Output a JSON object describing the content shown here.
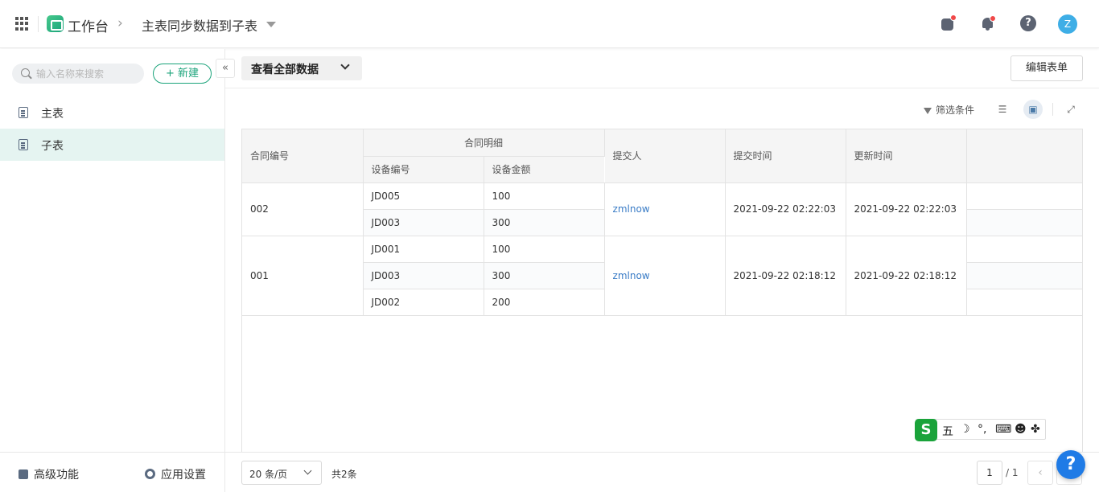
{
  "header": {
    "workspace_label": "工作台",
    "breadcrumb_separator": "›",
    "app_title": "主表同步数据到子表",
    "help_glyph": "?",
    "avatar_initial": "Z",
    "icons": [
      "apps-grid-icon",
      "app-logo-icon",
      "chevron-right-icon",
      "caret-down-icon",
      "app-store-icon",
      "bell-icon",
      "help-icon"
    ]
  },
  "sidebar": {
    "search_placeholder": "输入名称来搜索",
    "new_button_label": "+ 新建",
    "collapse_glyph": "«",
    "items": [
      {
        "label": "主表",
        "active": false,
        "icon": "sheet-icon"
      },
      {
        "label": "子表",
        "active": true,
        "icon": "sheet-icon"
      }
    ],
    "footer": {
      "advanced_label": "高级功能",
      "settings_label": "应用设置"
    }
  },
  "main": {
    "view_selector_label": "查看全部数据",
    "edit_form_label": "编辑表单",
    "filter_label": "筛选条件",
    "table": {
      "headers": {
        "contract_no": "合同编号",
        "detail_group": "合同明细",
        "device_no": "设备编号",
        "device_amount": "设备金额",
        "submitter": "提交人",
        "submit_time": "提交时间",
        "update_time": "更新时间"
      },
      "records": [
        {
          "contract_no": "002",
          "details": [
            {
              "device_no": "JD005",
              "device_amount": "100"
            },
            {
              "device_no": "JD003",
              "device_amount": "300"
            }
          ],
          "submitter": "zmlnow",
          "submit_time": "2021-09-22 02:22:03",
          "update_time": "2021-09-22 02:22:03"
        },
        {
          "contract_no": "001",
          "details": [
            {
              "device_no": "JD001",
              "device_amount": "100"
            },
            {
              "device_no": "JD003",
              "device_amount": "300"
            },
            {
              "device_no": "JD002",
              "device_amount": "200"
            }
          ],
          "submitter": "zmlnow",
          "submit_time": "2021-09-22 02:18:12",
          "update_time": "2021-09-22 02:18:12"
        }
      ]
    },
    "pager": {
      "page_size_label": "20 条/页",
      "total_label": "共2条",
      "current_page": "1",
      "total_pages_label": "/ 1",
      "prev_glyph": "‹"
    }
  },
  "ime": {
    "logo": "S",
    "mode": "五",
    "moon": "☽",
    "punct": "°,",
    "keyboard": "⌨",
    "user": "☻",
    "apps": "✤"
  },
  "floating_help": {
    "glyph": "?"
  },
  "colors": {
    "accent": "#1aa37a",
    "link": "#3a7cc6",
    "active_row": "#e5f4f1",
    "help_fab": "#1f7be6"
  }
}
